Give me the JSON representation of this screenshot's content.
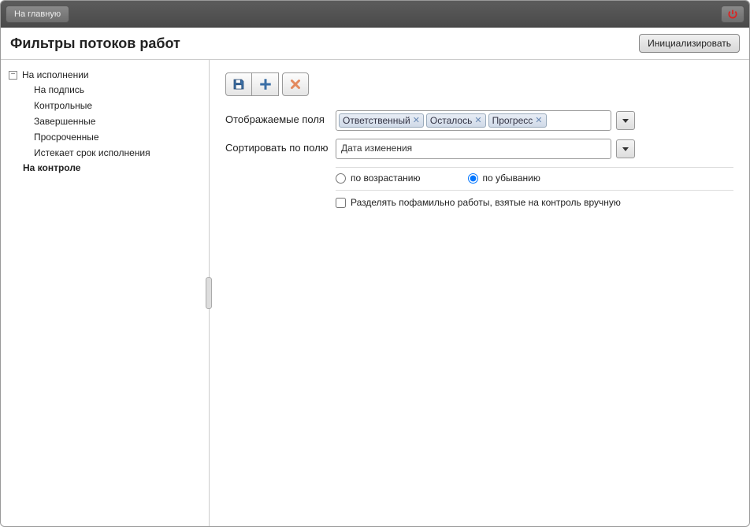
{
  "toolbar": {
    "home_label": "На главную"
  },
  "header": {
    "title": "Фильтры потоков работ",
    "init_button": "Инициализировать"
  },
  "sidebar": {
    "root": {
      "label": "На исполнении",
      "expanded": true,
      "children": [
        {
          "label": "На подпись"
        },
        {
          "label": "Контрольные"
        },
        {
          "label": "Завершенные"
        },
        {
          "label": "Просроченные"
        },
        {
          "label": "Истекает срок исполнения"
        }
      ]
    },
    "second_root": {
      "label": "На контроле"
    }
  },
  "form": {
    "display_fields_label": "Отображаемые поля",
    "display_fields_tags": [
      "Ответственный",
      "Осталось",
      "Прогресс"
    ],
    "sort_label": "Сортировать по полю",
    "sort_value": "Дата изменения",
    "radio_asc": "по возрастанию",
    "radio_desc": "по убыванию",
    "sort_direction": "desc",
    "checkbox_label": "Разделять пофамильно работы, взятые на контроль вручную",
    "checkbox_checked": false
  },
  "icons": {
    "save": "save-icon",
    "add": "plus-icon",
    "delete": "delete-icon",
    "power": "power-icon",
    "dropdown": "chevron-down-icon"
  }
}
